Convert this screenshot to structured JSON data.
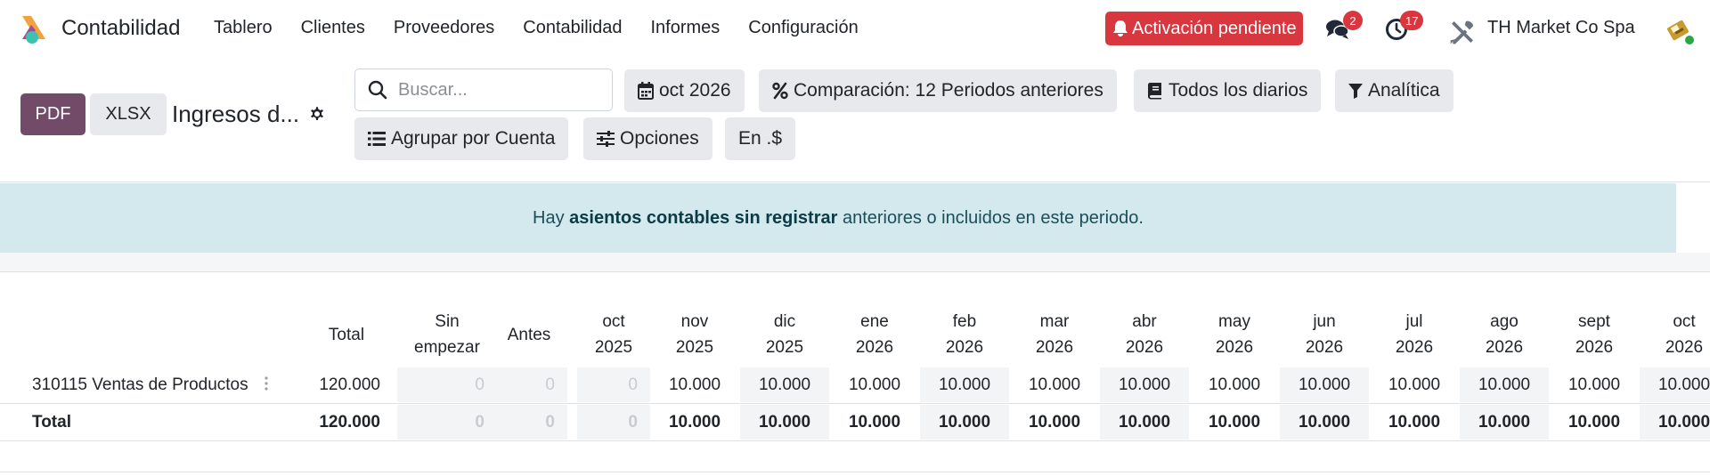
{
  "navbar": {
    "app_name": "Contabilidad",
    "menu": [
      "Tablero",
      "Clientes",
      "Proveedores",
      "Contabilidad",
      "Informes",
      "Configuración"
    ],
    "activation_label": "Activación pendiente",
    "messages_count": "2",
    "activities_count": "17",
    "company": "TH Market Co Spa"
  },
  "control": {
    "pdf_label": "PDF",
    "xlsx_label": "XLSX",
    "report_title": "Ingresos d...",
    "search_placeholder": "Buscar...",
    "filters": {
      "date": "oct 2026",
      "comparison": "Comparación: 12 Periodos anteriores",
      "journals": "Todos los diarios",
      "analytic": "Analítica",
      "group_by": "Agrupar por Cuenta",
      "options": "Opciones",
      "currency": "En .$"
    }
  },
  "alert": {
    "prefix": "Hay ",
    "link": "asientos contables sin registrar",
    "suffix": " anteriores o incluidos en este periodo."
  },
  "table": {
    "headers": [
      [
        "Total"
      ],
      [
        "Sin",
        "empezar"
      ],
      [
        "Antes"
      ],
      [
        "oct",
        "2025"
      ],
      [
        "nov",
        "2025"
      ],
      [
        "dic",
        "2025"
      ],
      [
        "ene",
        "2026"
      ],
      [
        "feb",
        "2026"
      ],
      [
        "mar",
        "2026"
      ],
      [
        "abr",
        "2026"
      ],
      [
        "may",
        "2026"
      ],
      [
        "jun",
        "2026"
      ],
      [
        "jul",
        "2026"
      ],
      [
        "ago",
        "2026"
      ],
      [
        "sept",
        "2026"
      ],
      [
        "oct",
        "2026"
      ]
    ],
    "rows": [
      {
        "label": "310115 Ventas de Productos",
        "values": [
          "120.000",
          "0",
          "0",
          "0",
          "10.000",
          "10.000",
          "10.000",
          "10.000",
          "10.000",
          "10.000",
          "10.000",
          "10.000",
          "10.000",
          "10.000",
          "10.000",
          "10.000"
        ]
      },
      {
        "label": "Total",
        "values": [
          "120.000",
          "0",
          "0",
          "0",
          "10.000",
          "10.000",
          "10.000",
          "10.000",
          "10.000",
          "10.000",
          "10.000",
          "10.000",
          "10.000",
          "10.000",
          "10.000",
          "10.000"
        ]
      }
    ]
  },
  "colors": {
    "brand": "#714b67",
    "danger": "#d9373f",
    "alert_bg": "#d3e9ee"
  }
}
